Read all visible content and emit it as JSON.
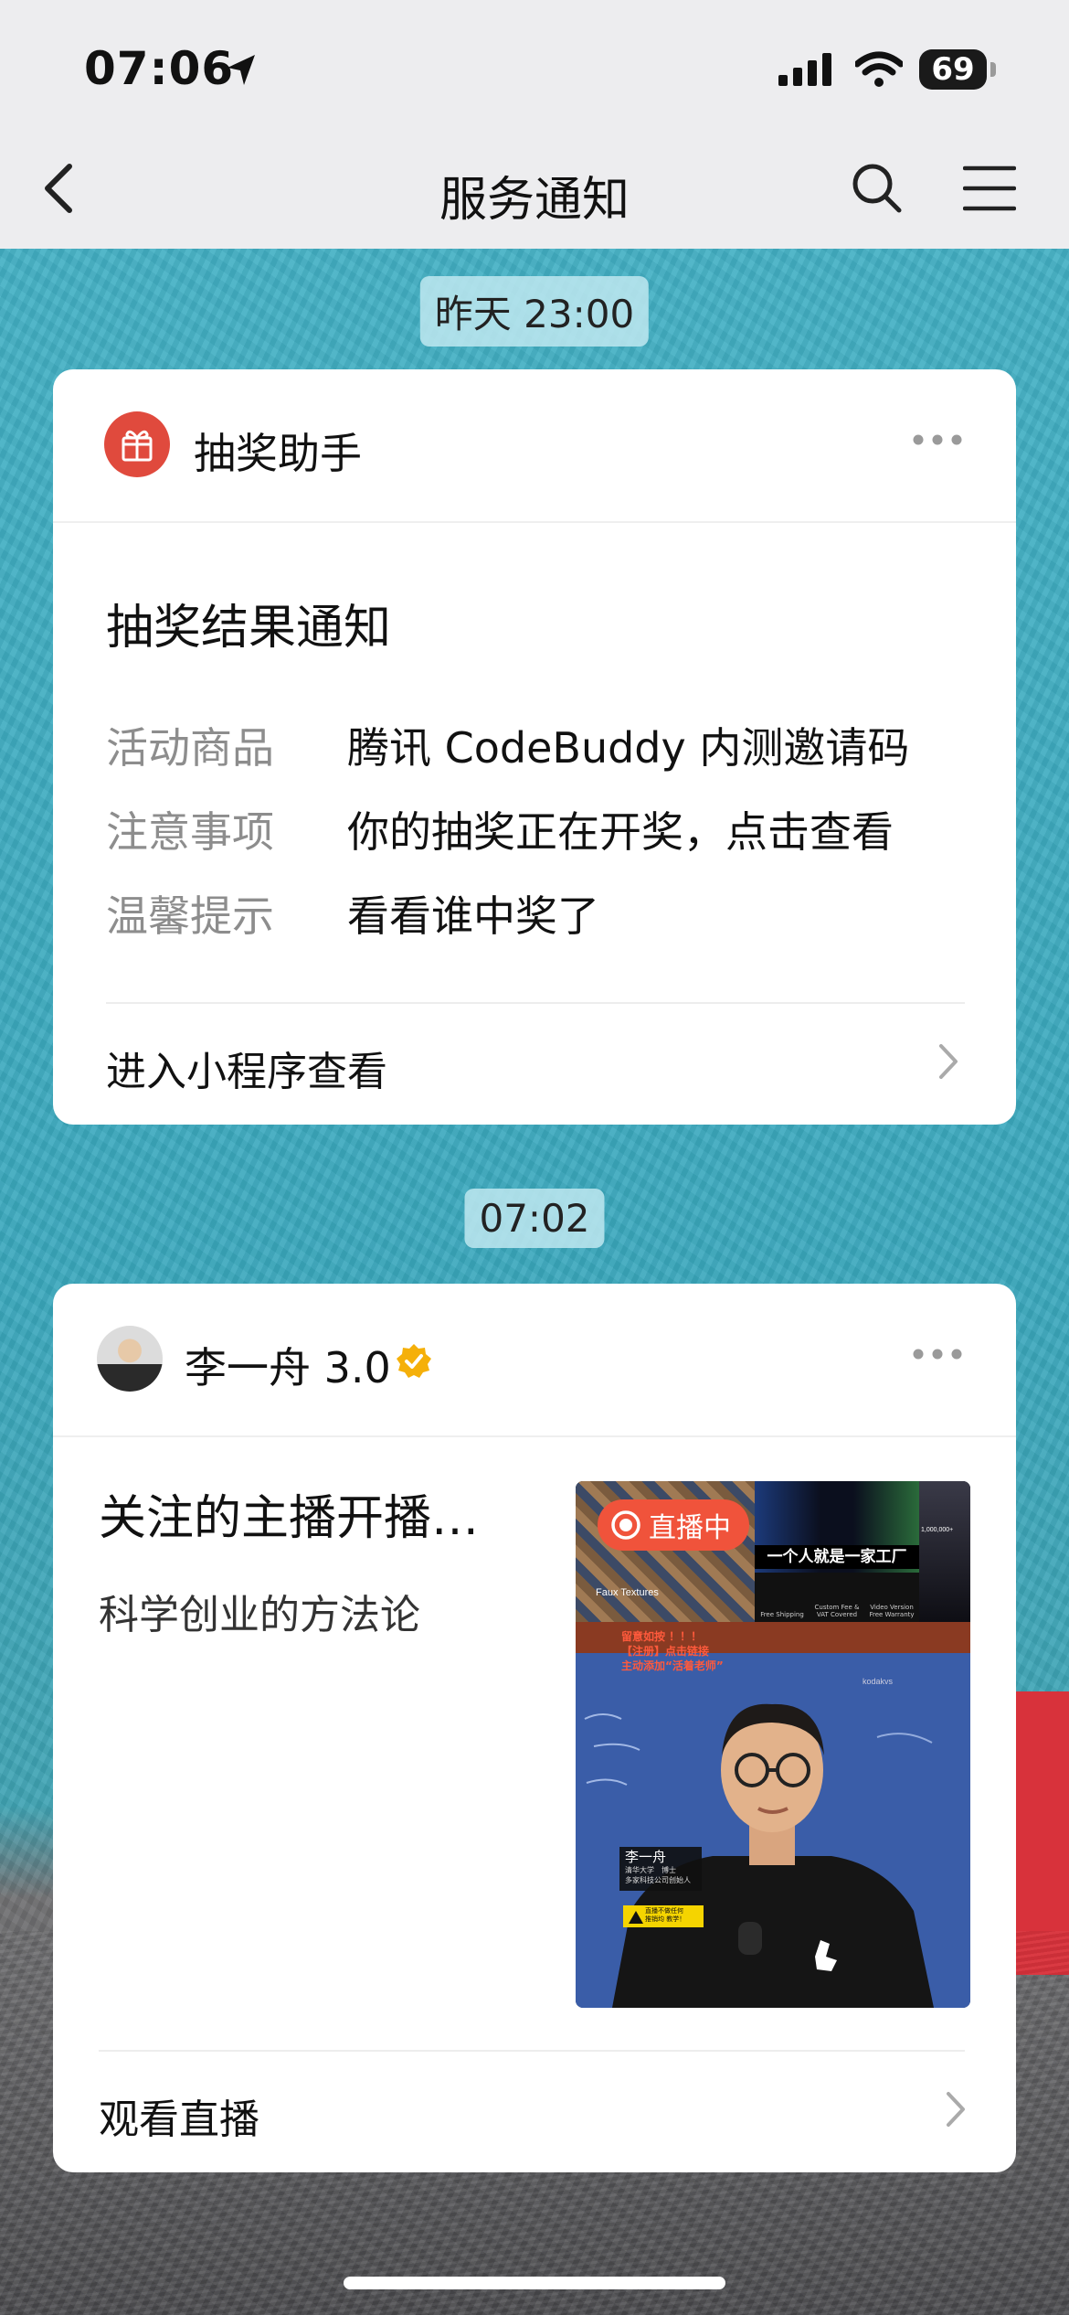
{
  "status_bar": {
    "time": "07:06",
    "battery": "69"
  },
  "nav": {
    "title": "服务通知"
  },
  "messages": [
    {
      "timestamp": "昨天 23:00",
      "sender": "抽奖助手",
      "title": "抽奖结果通知",
      "rows": [
        {
          "label": "活动商品",
          "value": "腾讯 CodeBuddy 内测邀请码"
        },
        {
          "label": "注意事项",
          "value": "你的抽奖正在开奖，点击查看"
        },
        {
          "label": "温馨提示",
          "value": "看看谁中奖了"
        }
      ],
      "footer": "进入小程序查看"
    },
    {
      "timestamp": "07:02",
      "sender": "李一舟 3.0",
      "title": "关注的主播开播…",
      "subtitle": "科学创业的方法论",
      "live_badge": "直播中",
      "thumb_banner": "一个人就是一家工厂",
      "thumb_texture_label": "Faux Textures",
      "thumb_stat": "1,000,000+",
      "thumb_features": [
        "Free Shipping",
        "Custom Fee & VAT Covered",
        "Video Version Free Warranty"
      ],
      "thumb_red_lines": [
        "留意如按 ！！！",
        "【注册】点击链接",
        "主动添加“活着老师”"
      ],
      "thumb_board_brand": "kodakvs",
      "thumb_name": "李一舟",
      "thumb_info": [
        "清华大学　博士",
        "多家科技公司创始人"
      ],
      "thumb_warning": [
        "直播不做任何",
        "推销均 教学！"
      ],
      "footer": "观看直播"
    }
  ],
  "colors": {
    "accent_red": "#e04a3d",
    "verified": "#f5b00a",
    "live_badge": "#f0533b"
  }
}
